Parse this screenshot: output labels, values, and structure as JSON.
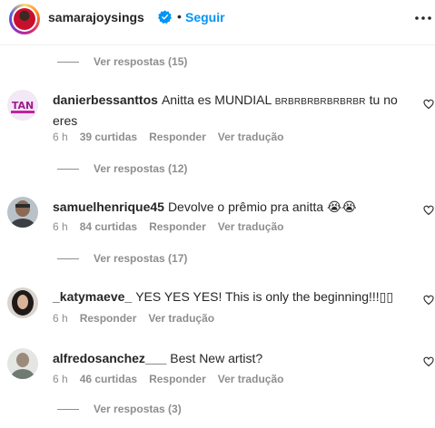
{
  "header": {
    "username": "samarajoysings",
    "separator": "•",
    "follow_label": "Seguir"
  },
  "replies_rows": [
    {
      "label": "Ver respostas (15)"
    },
    {
      "label": "Ver respostas (12)"
    },
    {
      "label": "Ver respostas (17)"
    },
    {
      "label": "Ver respostas (3)"
    }
  ],
  "comments": [
    {
      "username": "danierbessanttos",
      "text_before": "Anitta es MUNDIAL ",
      "text_caps": "BRBRBRBRBRBRBR",
      "text_after": " tu no eres",
      "time": "6 h",
      "likes": "39 curtidas",
      "reply": "Responder",
      "translate": "Ver tradução"
    },
    {
      "username": "samuelhenrique45",
      "text": "Devolve o prêmio pra anitta 😭😭",
      "time": "6 h",
      "likes": "84 curtidas",
      "reply": "Responder",
      "translate": "Ver tradução"
    },
    {
      "username": "_katymaeve_",
      "text": "YES YES YES! This is only the beginning!!!▯▯",
      "time": "6 h",
      "reply": "Responder",
      "translate": "Ver tradução"
    },
    {
      "username": "alfredosanchez___",
      "text": "Best New artist?",
      "time": "6 h",
      "likes": "46 curtidas",
      "reply": "Responder",
      "translate": "Ver tradução"
    }
  ],
  "colors": {
    "accent": "#0095f6",
    "verified": "#0095f6",
    "secondary_text": "#8e8e8e",
    "primary_text": "#262626"
  },
  "icons": [
    "verified-badge-icon",
    "more-options-icon",
    "heart-icon"
  ]
}
